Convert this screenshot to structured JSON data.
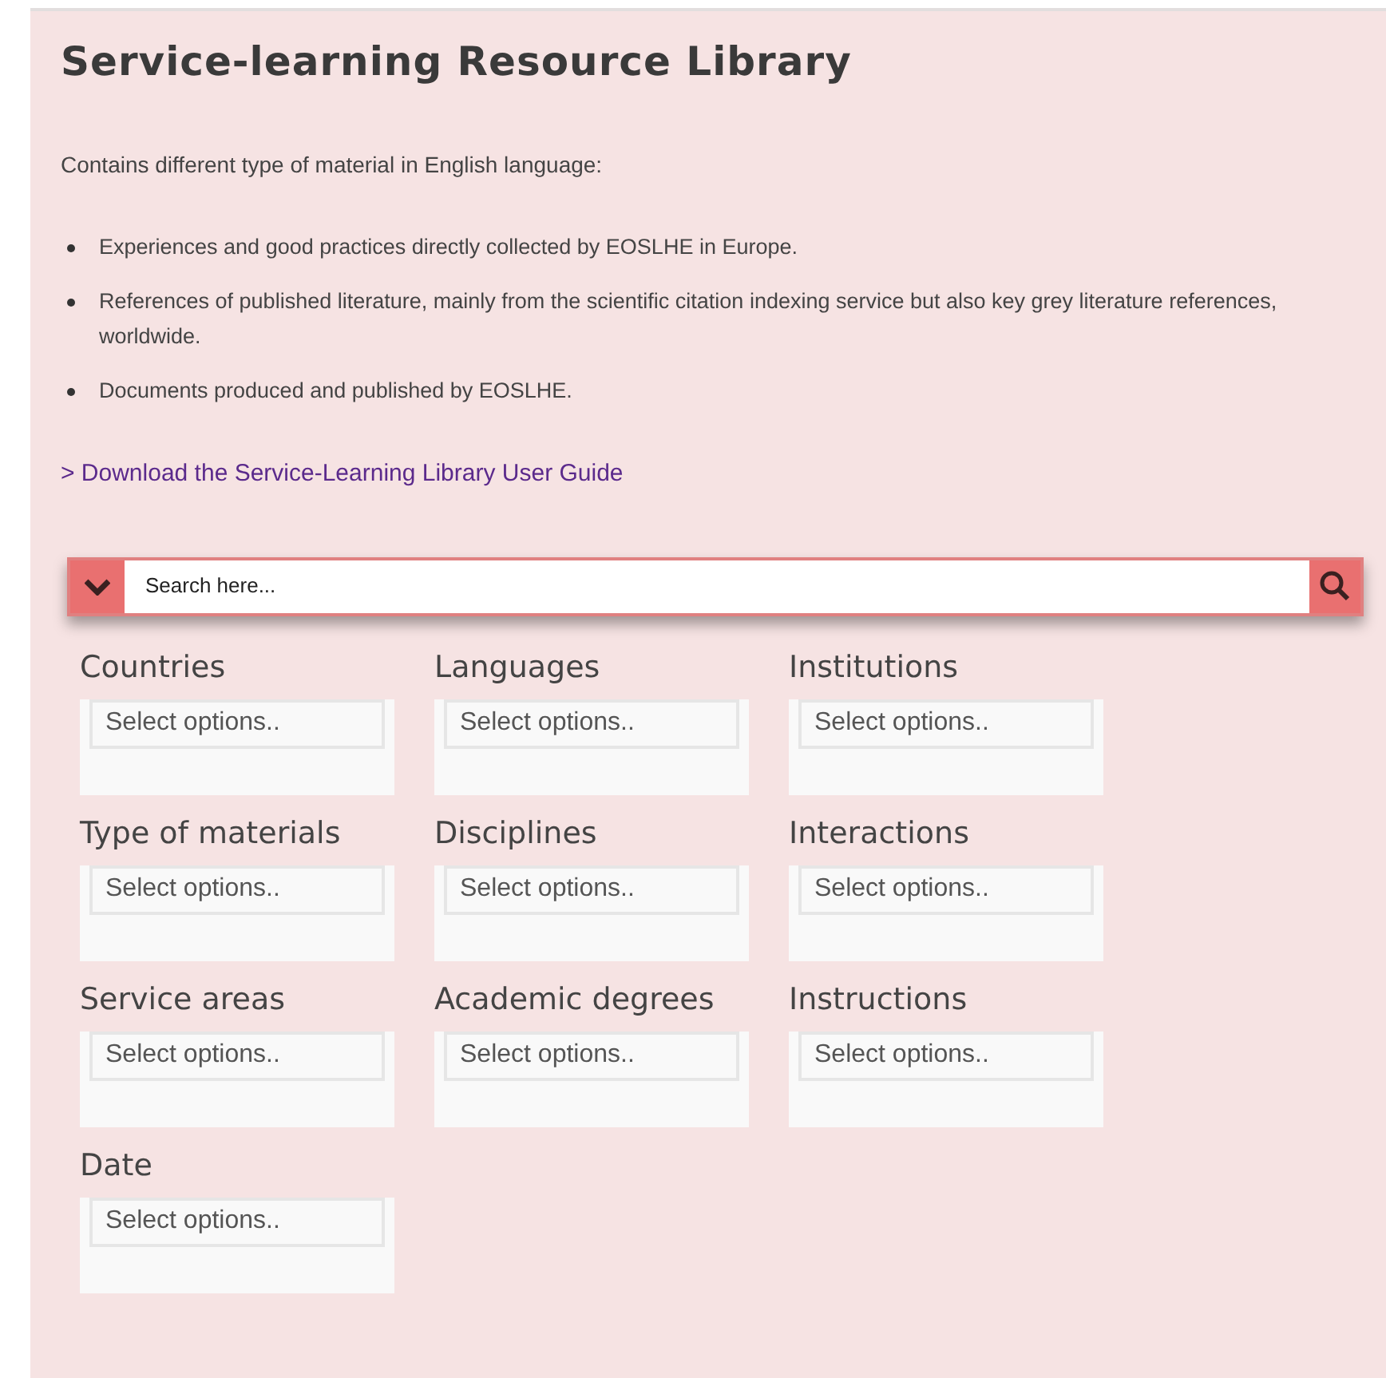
{
  "title": "Service-learning Resource Library",
  "intro": "Contains different type of material in English language:",
  "bullets": [
    "Experiences and good practices directly collected by EOSLHE in Europe.",
    "References of published literature, mainly from the scientific citation indexing service but also key grey literature references, worldwide.",
    "Documents produced and published by EOSLHE."
  ],
  "download_link": "> Download the Service-Learning Library User Guide",
  "search": {
    "placeholder": "Search here..."
  },
  "filters": [
    {
      "label": "Countries",
      "placeholder": "Select options.."
    },
    {
      "label": "Languages",
      "placeholder": "Select options.."
    },
    {
      "label": "Institutions",
      "placeholder": "Select options.."
    },
    {
      "label": "Type of materials",
      "placeholder": "Select options.."
    },
    {
      "label": "Disciplines",
      "placeholder": "Select options.."
    },
    {
      "label": "Interactions",
      "placeholder": "Select options.."
    },
    {
      "label": "Service areas",
      "placeholder": "Select options.."
    },
    {
      "label": "Academic degrees",
      "placeholder": "Select options.."
    },
    {
      "label": "Instructions",
      "placeholder": "Select options.."
    },
    {
      "label": "Date",
      "placeholder": "Select options.."
    }
  ]
}
